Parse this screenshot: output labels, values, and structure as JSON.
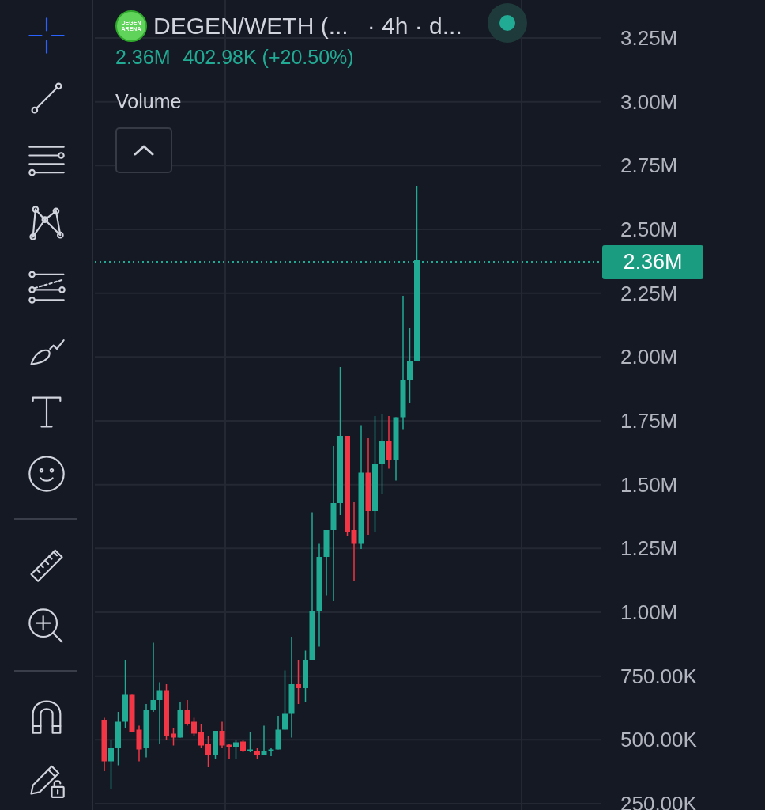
{
  "toolbar": {
    "groups": [
      {
        "tools": [
          {
            "selected": true
          },
          {
            "selected": false
          },
          {
            "selected": false
          },
          {
            "selected": false
          },
          {
            "selected": false
          },
          {
            "selected": false
          },
          {
            "selected": false
          },
          {
            "selected": false
          }
        ]
      },
      {
        "tools": [
          {
            "selected": false
          },
          {
            "selected": false
          }
        ]
      },
      {
        "tools": [
          {
            "selected": false
          },
          {
            "selected": false
          }
        ]
      }
    ]
  },
  "legend": {
    "logo_lines": [
      "DEGEN",
      "ARENA"
    ],
    "symbol": "DEGEN/WETH (...",
    "interval": "· 4h · d...",
    "live": true,
    "last": "2.36M",
    "change": "402.98K (+20.50%)"
  },
  "volume_pane": {
    "label": "Volume"
  },
  "price_scale": {
    "labels": [
      "3.25M",
      "3.00M",
      "2.75M",
      "2.50M",
      "2.25M",
      "2.00M",
      "1.75M",
      "1.50M",
      "1.25M",
      "1.00M",
      "750.00K",
      "500.00K",
      "250.00K"
    ],
    "last_price": "2.36M"
  }
}
